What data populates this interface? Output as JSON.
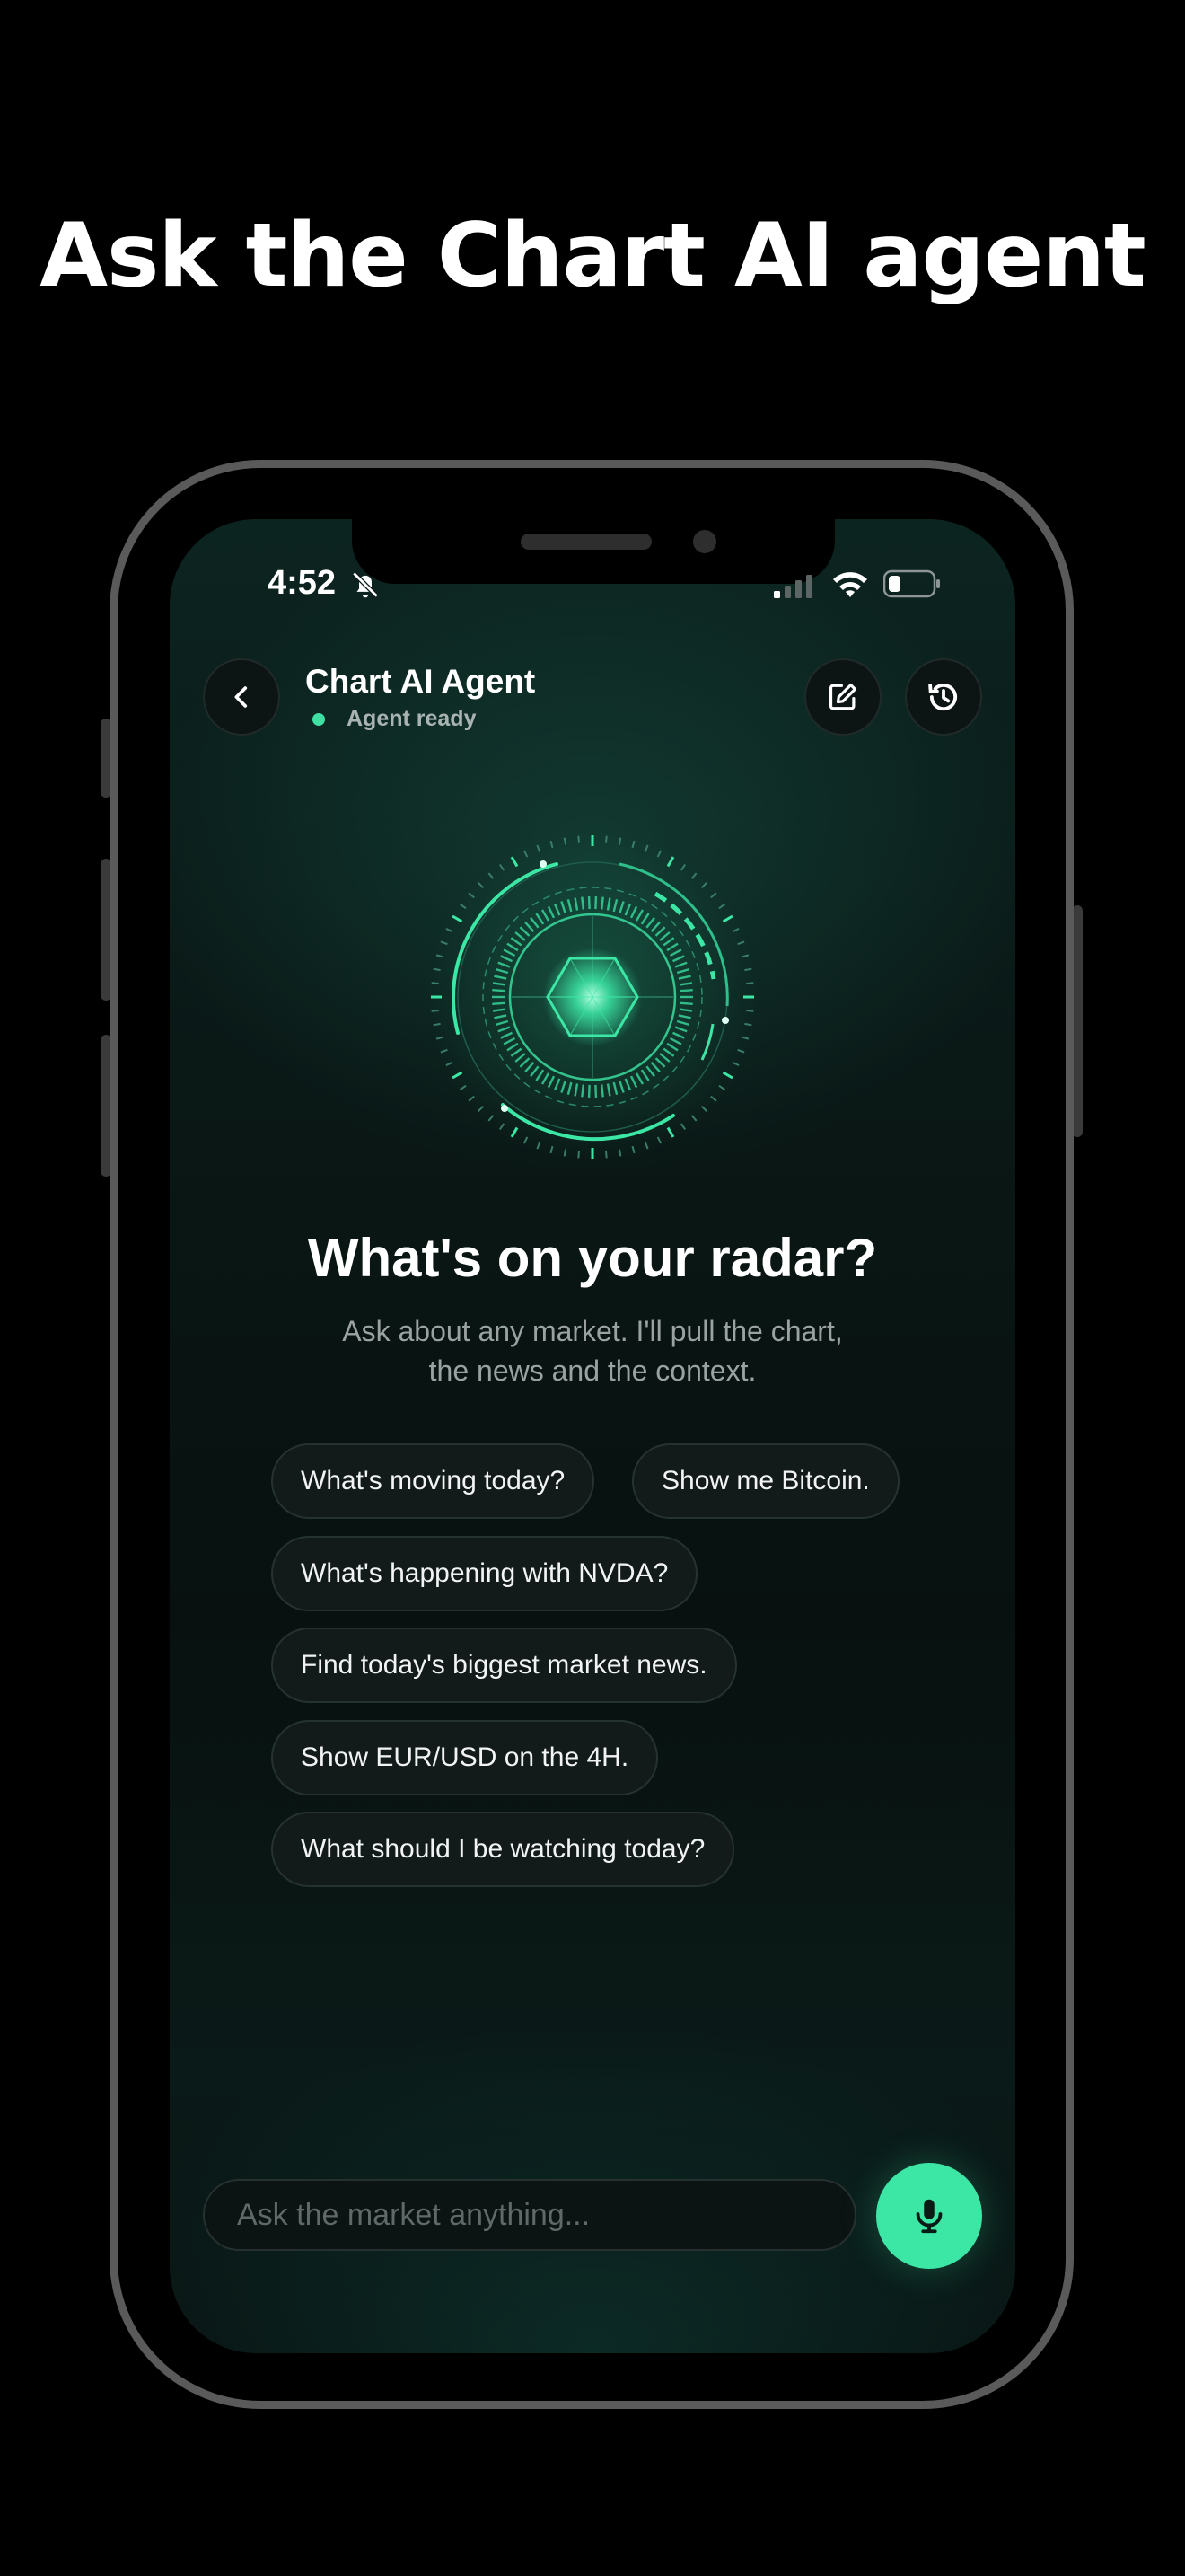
{
  "headline": "Ask the Chart AI agent",
  "status_bar": {
    "time": "4:52",
    "icons": [
      "bell-slash-icon",
      "signal-icon",
      "wifi-icon",
      "battery-icon"
    ]
  },
  "header": {
    "back_icon": "chevron-left-icon",
    "title": "Chart AI Agent",
    "status": "Agent ready",
    "new_chat_icon": "edit-icon",
    "history_icon": "history-icon"
  },
  "hero": {
    "title": "What's on your radar?",
    "subtitle_line1": "Ask about any market. I'll pull the chart,",
    "subtitle_line2": "the news and the context."
  },
  "suggestions": [
    "What's moving today?",
    "Show me Bitcoin.",
    "What's happening with NVDA?",
    "Find today's biggest market news.",
    "Show EUR/USD on the 4H.",
    "What should I be watching today?"
  ],
  "composer": {
    "placeholder": "Ask the market anything...",
    "mic_icon": "microphone-icon"
  },
  "colors": {
    "accent": "#3ce7a6",
    "background": "#000000",
    "chip_bg": "#121a1a"
  }
}
